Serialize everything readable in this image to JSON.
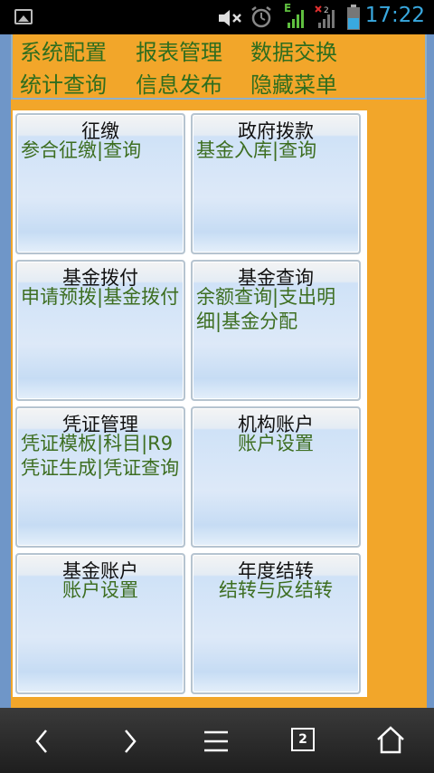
{
  "status_bar": {
    "time": "17:22",
    "network_type": "E",
    "icons": [
      "picture-icon",
      "mute-icon",
      "alarm-icon",
      "signal-icon",
      "no-signal-icon",
      "battery-icon"
    ]
  },
  "menu": {
    "row1": [
      "系统配置",
      "报表管理",
      "数据交换"
    ],
    "row2": [
      "统计查询",
      "信息发布",
      "隐藏菜单"
    ]
  },
  "tiles": [
    {
      "title": "征缴",
      "links": "参合征缴|查询"
    },
    {
      "title": "政府拨款",
      "links": "基金入库|查询"
    },
    {
      "title": "基金拨付",
      "links": "申请预拨|基金拨付"
    },
    {
      "title": "基金查询",
      "links": "余额查询|支出明细|基金分配"
    },
    {
      "title": "凭证管理",
      "links": "凭证模板|科目|R9凭证生成|凭证查询"
    },
    {
      "title": "机构账户",
      "links": "账户设置"
    },
    {
      "title": "基金账户",
      "links": "账户设置"
    },
    {
      "title": "年度结转",
      "links": "结转与反结转"
    }
  ],
  "nav": {
    "tab_count": "2",
    "icons": [
      "back-arrow-icon",
      "forward-arrow-icon",
      "menu-icon",
      "tabs-icon",
      "home-icon"
    ]
  },
  "colors": {
    "page_bg": "#f2a62a",
    "menu_text": "#2f6d1e",
    "link_text": "#3d6e21",
    "status_time": "#39a9e0"
  }
}
